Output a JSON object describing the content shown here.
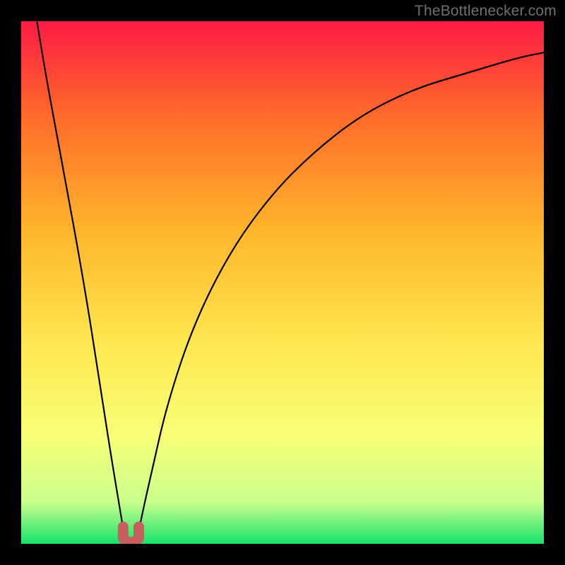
{
  "watermark": "TheBottlenecker.com",
  "colors": {
    "gradient_top": "#ff1a44",
    "gradient_mid1": "#ff6a2a",
    "gradient_mid2": "#ffb52b",
    "gradient_mid3": "#ffe851",
    "gradient_mid4": "#f6ff77",
    "gradient_mid5": "#c9ff8d",
    "gradient_bottom": "#17e36a",
    "curve": "#000000",
    "knot": "#c85e5e",
    "frame": "#000000"
  },
  "chart_data": {
    "type": "line",
    "title": "",
    "xlabel": "",
    "ylabel": "",
    "xlim": [
      0,
      100
    ],
    "ylim": [
      0,
      100
    ],
    "background_gradient": {
      "direction": "vertical",
      "stops_pct_value": [
        [
          0,
          100
        ],
        [
          50,
          50
        ],
        [
          82,
          18
        ],
        [
          100,
          0
        ]
      ],
      "description": "vertical heat gradient: red = 100% bottleneck at top, green = 0% at bottom"
    },
    "series": [
      {
        "name": "bottleneck-curve",
        "x": [
          3,
          5,
          8,
          12,
          15,
          17,
          19,
          20,
          21,
          22,
          23,
          25,
          28,
          33,
          40,
          48,
          56,
          65,
          75,
          85,
          95,
          100
        ],
        "y": [
          100,
          88,
          72,
          50,
          31,
          18,
          6,
          0,
          0,
          0,
          5,
          14,
          27,
          42,
          56,
          67,
          75,
          82,
          87,
          90,
          93,
          94
        ]
      }
    ],
    "annotations": [
      {
        "name": "minimum-knot",
        "kind": "U-shaped marker",
        "x_range": [
          19.5,
          22.5
        ],
        "y": 0,
        "color": "#c85e5e"
      }
    ]
  }
}
